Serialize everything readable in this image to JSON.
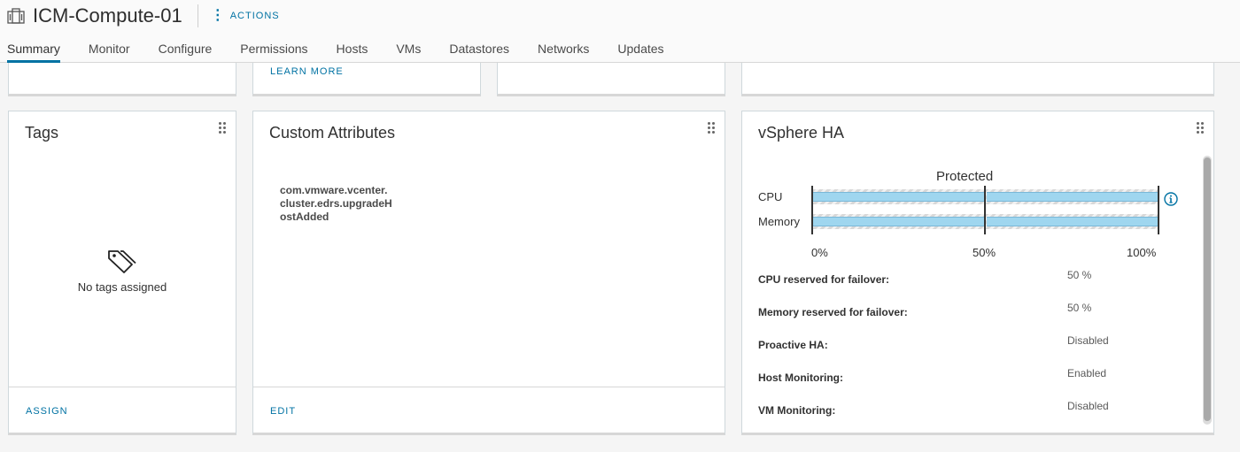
{
  "header": {
    "title": "ICM-Compute-01",
    "actions_label": "ACTIONS",
    "icon": "cluster-icon"
  },
  "tabs": [
    {
      "label": "Summary",
      "active": true
    },
    {
      "label": "Monitor"
    },
    {
      "label": "Configure"
    },
    {
      "label": "Permissions"
    },
    {
      "label": "Hosts"
    },
    {
      "label": "VMs"
    },
    {
      "label": "Datastores"
    },
    {
      "label": "Networks"
    },
    {
      "label": "Updates"
    }
  ],
  "top_cards": {
    "learn_more": "LEARN MORE"
  },
  "tags": {
    "title": "Tags",
    "empty_text": "No tags assigned",
    "assign_label": "ASSIGN",
    "icon": "tag-icon"
  },
  "custom_attributes": {
    "title": "Custom Attributes",
    "attribute": "com.vmware.vcenter.\ncluster.edrs.upgradeH\nostAdded",
    "edit_label": "EDIT"
  },
  "vsphere_ha": {
    "title": "vSphere HA",
    "status": "Protected",
    "resources": [
      {
        "label": "CPU",
        "reserved_percent": 50
      },
      {
        "label": "Memory",
        "reserved_percent": 50
      }
    ],
    "axis_ticks": [
      "0%",
      "50%",
      "100%"
    ],
    "rows": [
      {
        "label": "CPU reserved for failover:",
        "value": "50 %"
      },
      {
        "label": "Memory reserved for failover:",
        "value": "50 %"
      },
      {
        "label": "Proactive HA:",
        "value": "Disabled"
      },
      {
        "label": "Host Monitoring:",
        "value": "Enabled"
      },
      {
        "label": "VM Monitoring:",
        "value": "Disabled"
      }
    ]
  },
  "colors": {
    "accent": "#0072a3",
    "bar_fill": "#9fd6ef"
  }
}
